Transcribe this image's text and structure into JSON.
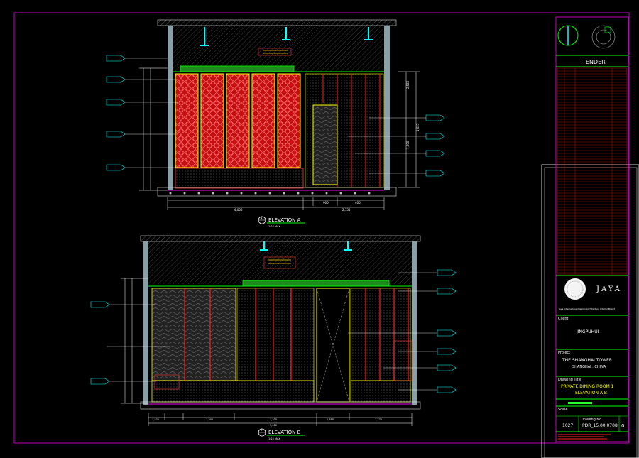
{
  "colors": {
    "background": "#000000",
    "border_magenta": "#c000c0",
    "cyan": "#00ffff",
    "green": "#00ff00",
    "yellow": "#ffff00",
    "red": "#ff0000",
    "panel_red": "#cc1010",
    "wall_grey": "#8aa0a6",
    "white": "#ffffff"
  },
  "title_block": {
    "status": "TENDER",
    "brand": "JAYA",
    "brand_tagline": "Jaya International Design  Architecture  Interior  Brand",
    "client_label": "Client",
    "client": "JINGPUHUI",
    "project_label": "Project",
    "project_line1": "THE SHANGHAI TOWER",
    "project_line2": "SHANGHAI . CHINA",
    "drawing_title_label": "Drawing Title",
    "drawing_title_line1": "PRIVATE DINING ROOM 1",
    "drawing_title_line2": "ELEVATION A B",
    "scale_label": "Scale",
    "drawing_no_label": "Drawing No.",
    "sheet_no": "1027",
    "drawing_no": "PDR_15.00.0708",
    "revision": "0"
  },
  "views": [
    {
      "number": "1",
      "title": "ELEVATION A",
      "scale": "1:25 MAX"
    },
    {
      "number": "2",
      "title": "ELEVATION B",
      "scale": "1:25 MAX"
    }
  ],
  "elevation_a": {
    "dimensions_bottom": [
      "4,000",
      "900",
      "400",
      "2,155"
    ],
    "dim_right": [
      "2,560",
      "1,200",
      "1,025"
    ]
  },
  "elevation_b": {
    "dimensions_bottom": [
      "1,275",
      "1,300",
      "3,000",
      "1,200",
      "1,350",
      "1,275"
    ]
  }
}
